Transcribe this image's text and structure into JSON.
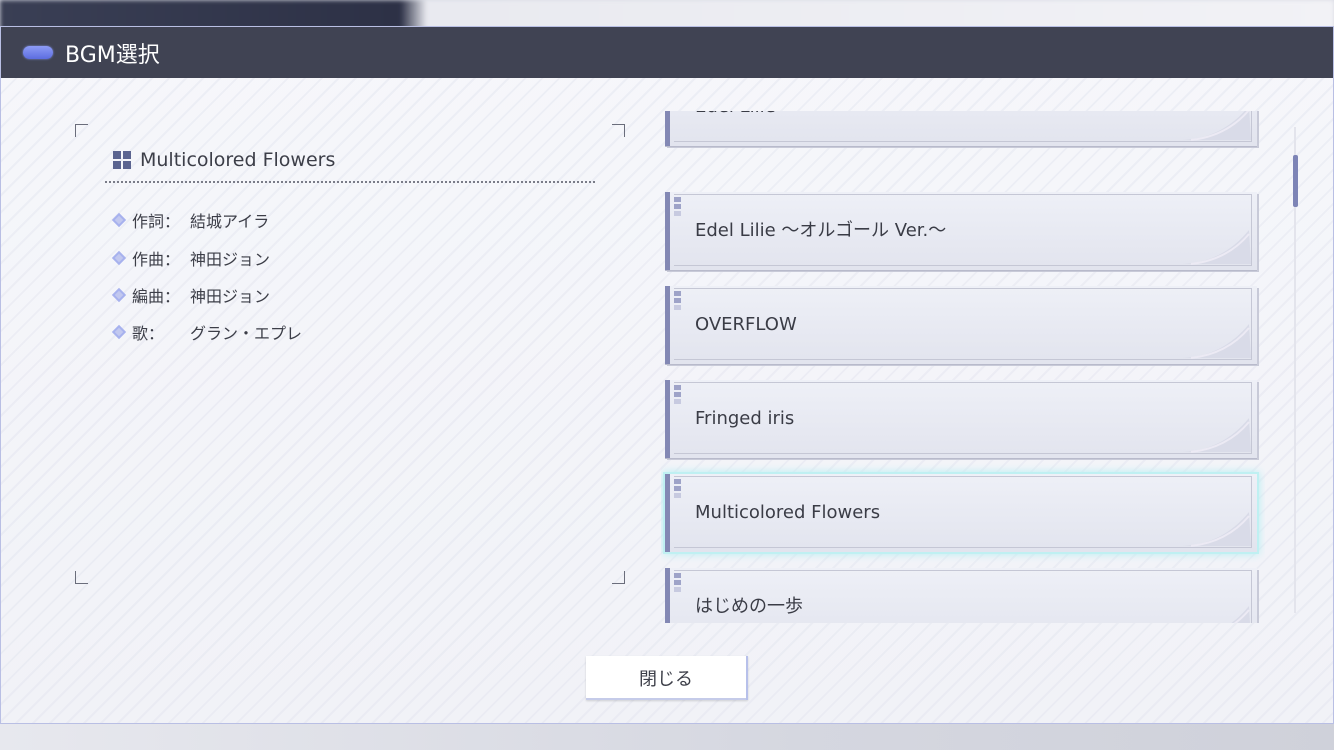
{
  "dialog": {
    "title": "BGM選択",
    "close_label": "閉じる"
  },
  "details": {
    "song_title": "Multicolored Flowers",
    "rows": [
      {
        "label": "作詞：",
        "value": "結城アイラ"
      },
      {
        "label": "作曲：",
        "value": "神田ジョン"
      },
      {
        "label": "編曲：",
        "value": "神田ジョン"
      },
      {
        "label": "歌：",
        "value": "グラン・エプレ"
      }
    ]
  },
  "bgm_list": {
    "items": [
      {
        "title": "Edel Lilie"
      },
      {
        "title": "Edel Lilie 〜オルゴール Ver.〜"
      },
      {
        "title": "OVERFLOW"
      },
      {
        "title": "Fringed iris"
      },
      {
        "title": "Multicolored Flowers"
      },
      {
        "title": "はじめの一歩"
      }
    ],
    "selected_index": 4
  },
  "colors": {
    "accent": "#7d84b6",
    "titlebar": "#404353",
    "selected_glow": "#bff0f2"
  }
}
